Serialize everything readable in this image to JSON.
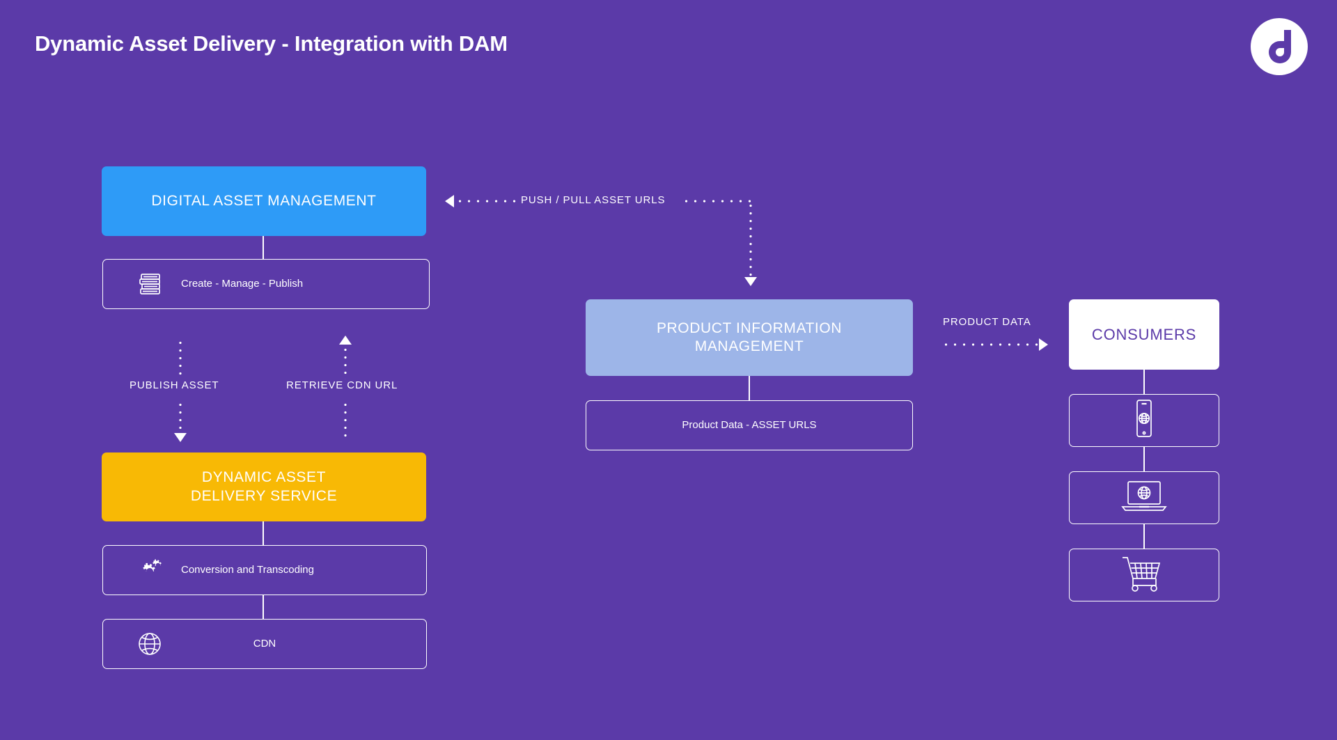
{
  "page": {
    "title": "Dynamic Asset Delivery - Integration with DAM",
    "background_color": "#5b3aa8"
  },
  "logo": {
    "name": "dynamic-media-logo",
    "letter": "d",
    "circle_color": "#ffffff",
    "glyph_color": "#5b3aa8"
  },
  "colors": {
    "purple_bg": "#5b3aa8",
    "blue": "#2e9bf7",
    "yellow": "#f8b905",
    "periwinkle": "#9db5e8",
    "white": "#ffffff"
  },
  "nodes": {
    "dam": {
      "label": "DIGITAL ASSET MANAGEMENT",
      "fill": "#2e9bf7"
    },
    "dam_detail": {
      "label": "Create - Manage - Publish",
      "icon": "books-stack-icon"
    },
    "dads": {
      "line1": "DYNAMIC ASSET",
      "line2": "DELIVERY SERVICE",
      "fill": "#f8b905"
    },
    "conversion": {
      "label": "Conversion and Transcoding",
      "icon": "gears-icon"
    },
    "cdn": {
      "label": "CDN",
      "icon": "globe-icon"
    },
    "pim": {
      "line1": "PRODUCT INFORMATION",
      "line2": "MANAGEMENT",
      "fill": "#9db5e8"
    },
    "pim_detail": {
      "label": "Product Data - ASSET URLS"
    },
    "consumers": {
      "label": "CONSUMERS",
      "fill": "#ffffff"
    },
    "channel_mobile": {
      "icon": "mobile-phone-globe-icon"
    },
    "channel_laptop": {
      "icon": "laptop-globe-icon"
    },
    "channel_cart": {
      "icon": "shopping-cart-icon"
    }
  },
  "flows": {
    "publish_asset": {
      "label": "PUBLISH ASSET",
      "direction": "down"
    },
    "retrieve_cdn_url": {
      "label": "RETRIEVE CDN URL",
      "direction": "up"
    },
    "push_pull_asset_urls": {
      "label": "PUSH / PULL ASSET URLS",
      "direction": "bidirectional"
    },
    "product_data": {
      "label": "PRODUCT DATA",
      "direction": "right"
    }
  }
}
